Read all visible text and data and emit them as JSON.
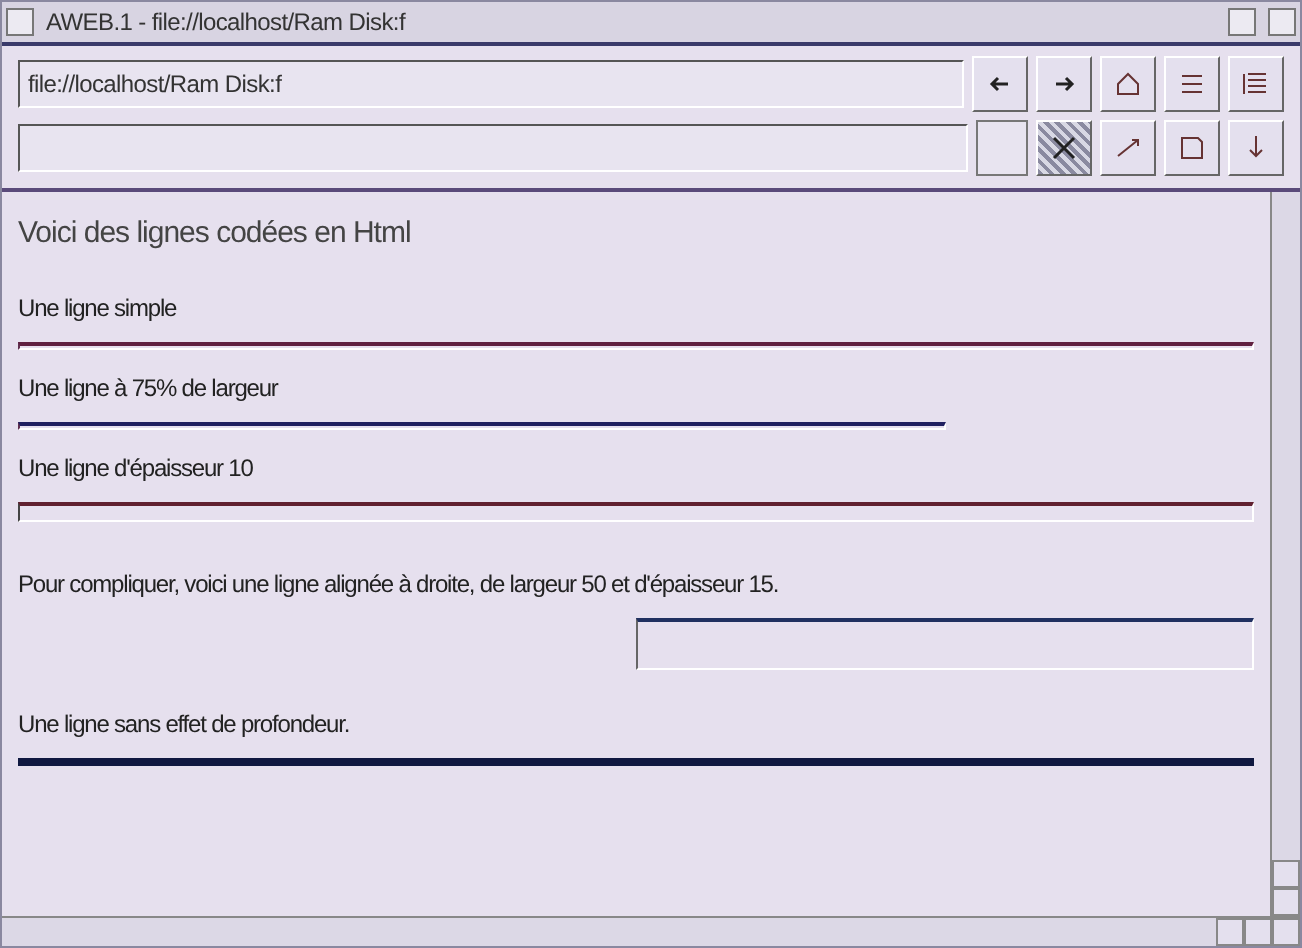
{
  "window": {
    "title": "AWEB.1 - file://localhost/Ram Disk:f"
  },
  "toolbar": {
    "url": "file://localhost/Ram Disk:f"
  },
  "content": [
    {
      "kind": "heading",
      "text": "Voici des lignes codées en Html"
    },
    {
      "kind": "text",
      "text": "Une ligne simple"
    },
    {
      "kind": "rule-full"
    },
    {
      "kind": "text",
      "text": "Une ligne à 75% de largeur"
    },
    {
      "kind": "rule-75"
    },
    {
      "kind": "text",
      "text": "Une ligne d'épaisseur 10"
    },
    {
      "kind": "rule-thick"
    },
    {
      "kind": "text",
      "text": "Pour compliquer, voici une ligne alignée à droite, de largeur 50 et d'épaisseur 15."
    },
    {
      "kind": "rule-right-thick"
    },
    {
      "kind": "text",
      "text": "Une ligne sans effet de profondeur."
    },
    {
      "kind": "rule-flat"
    }
  ]
}
